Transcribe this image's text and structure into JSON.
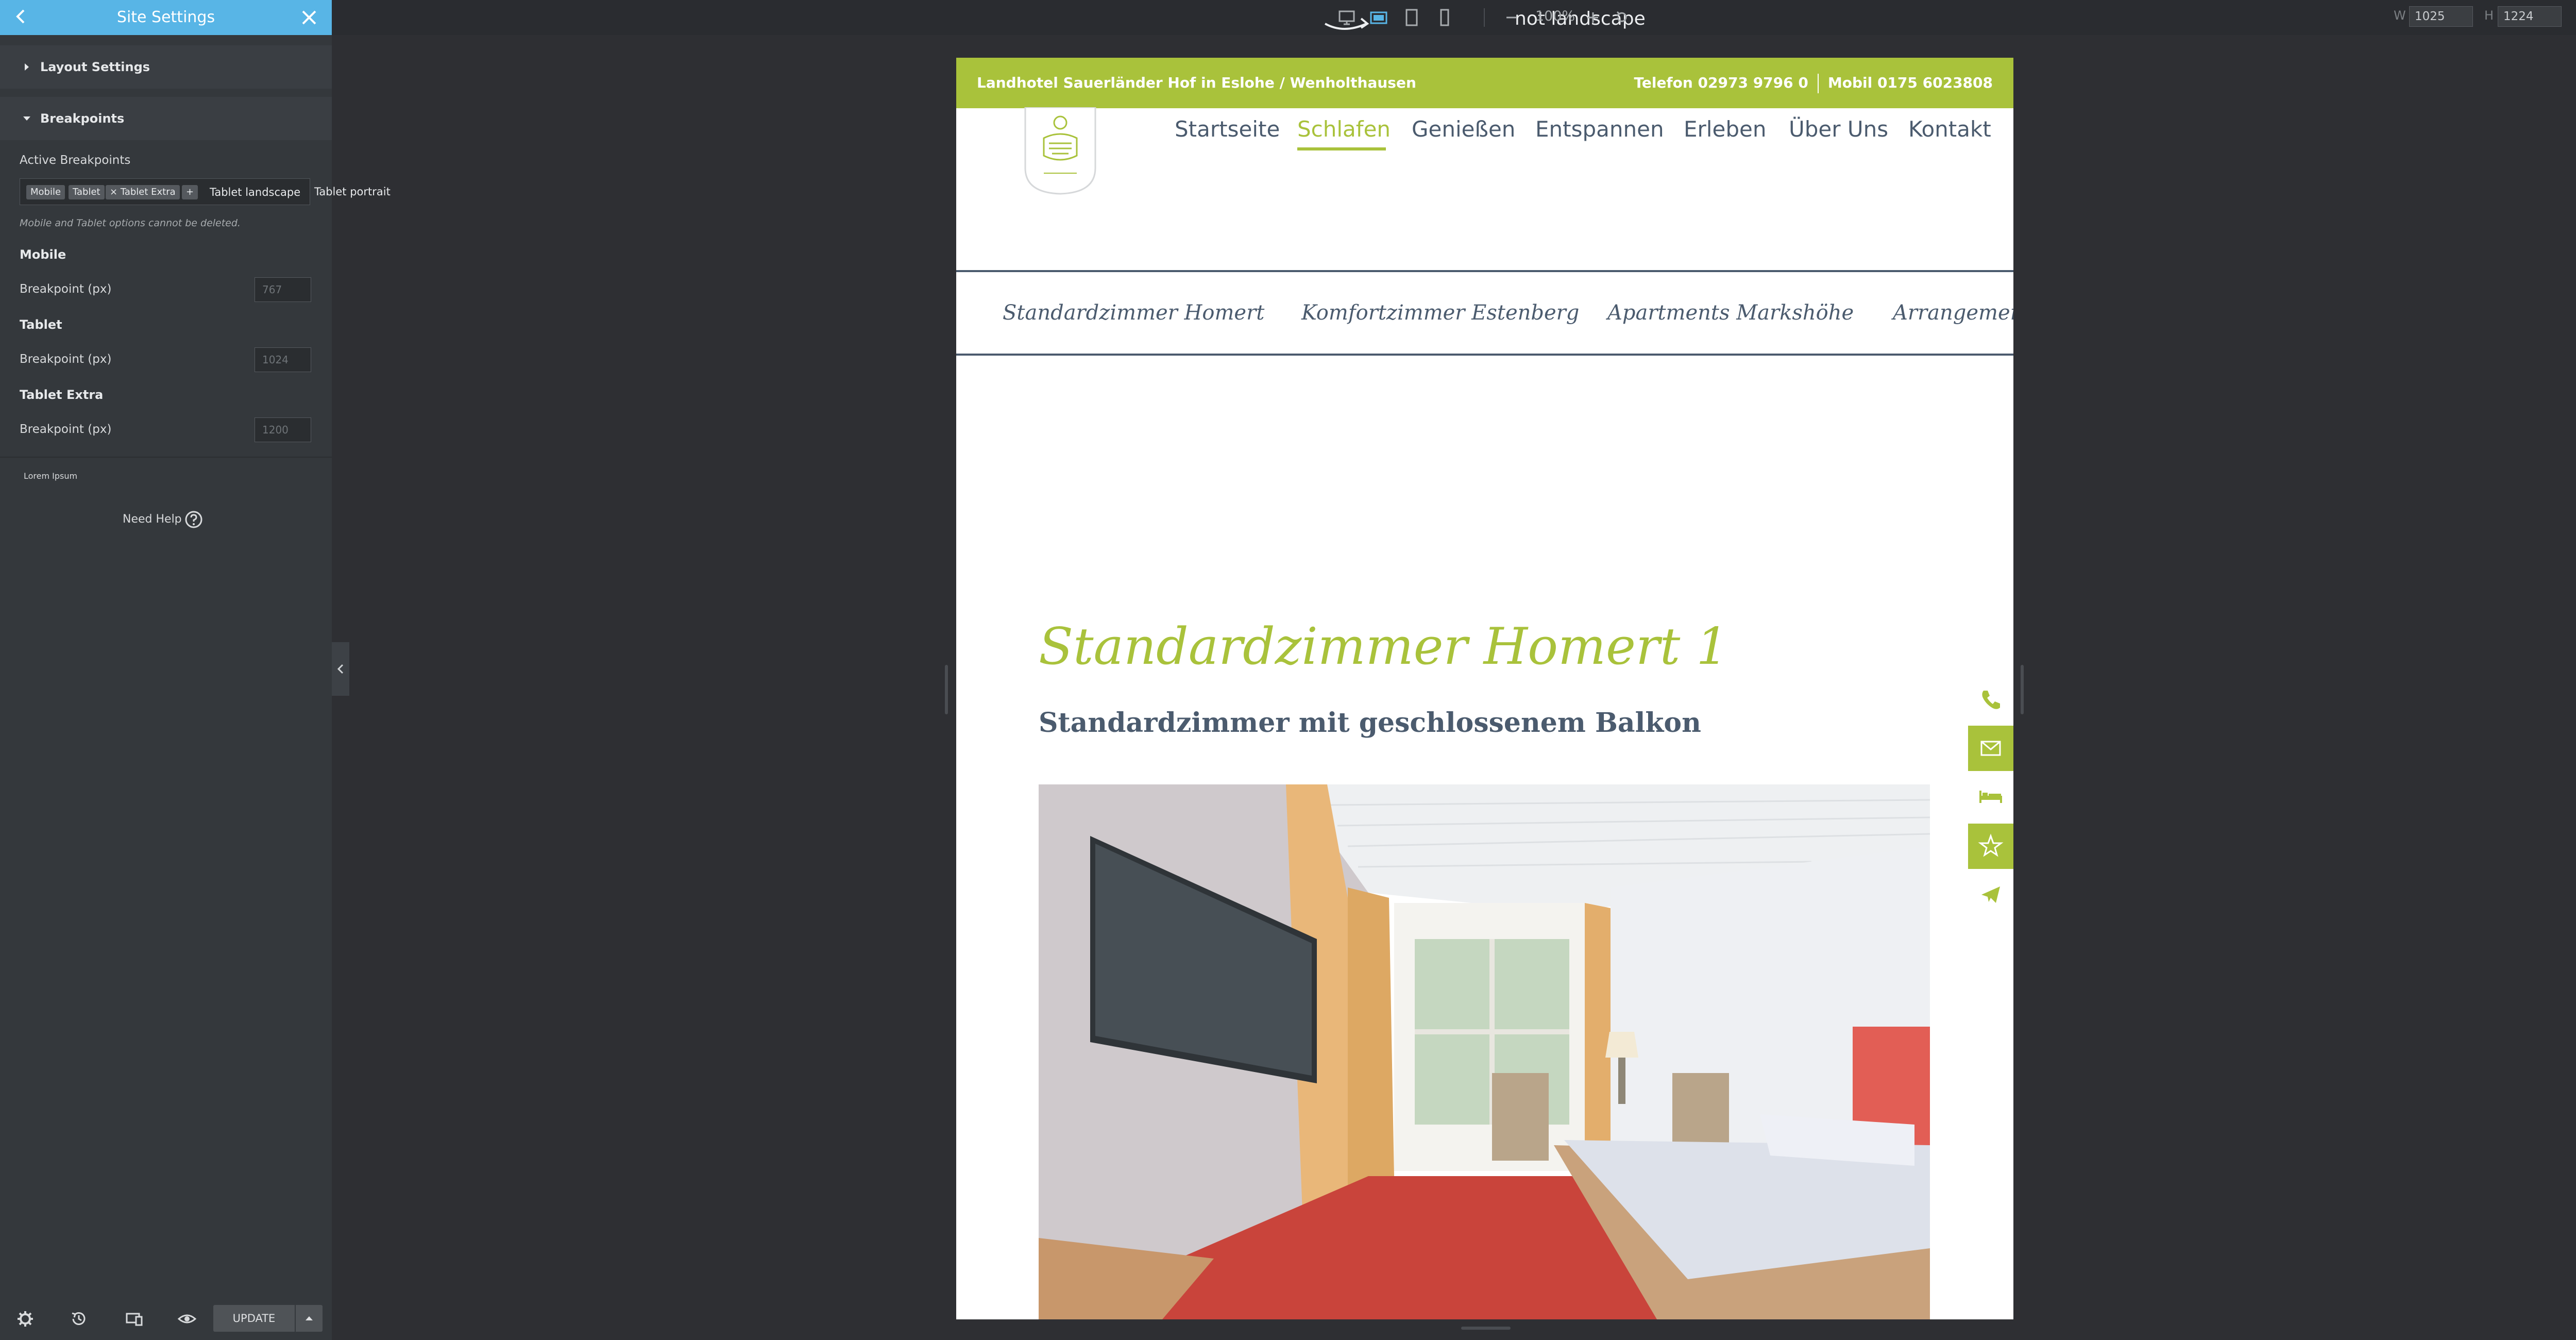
{
  "sidebar": {
    "title": "Site Settings",
    "sections": {
      "layout": "Layout Settings",
      "breakpoints": "Breakpoints"
    },
    "active_breakpoints_label": "Active Breakpoints",
    "tags": [
      "Mobile",
      "Tablet",
      "Tablet Extra"
    ],
    "tag_remove": "×",
    "add": "+",
    "option_landscape": "Tablet landscape",
    "option_portrait": "Tablet portrait",
    "note": "Mobile and Tablet options cannot be deleted.",
    "groups": [
      {
        "title": "Mobile",
        "field_label": "Breakpoint (px)",
        "placeholder": "767"
      },
      {
        "title": "Tablet",
        "field_label": "Breakpoint (px)",
        "placeholder": "1024"
      },
      {
        "title": "Tablet Extra",
        "field_label": "Breakpoint (px)",
        "placeholder": "1200"
      }
    ],
    "lorem": "Lorem Ipsum",
    "need_help": "Need Help",
    "update_label": "UPDATE"
  },
  "topbar": {
    "mode_note": "not landscape",
    "zoom": "100%",
    "width_label": "W",
    "width_value": "1025",
    "height_label": "H",
    "height_value": "1224"
  },
  "site": {
    "topbar_left": "Landhotel Sauerländer Hof in Eslohe / Wenholthausen",
    "phone": "Telefon 02973 9796 0",
    "mobile": "Mobil 0175 6023808",
    "nav": [
      "Startseite",
      "Schlafen",
      "Genießen",
      "Entspannen",
      "Erleben",
      "Über Uns",
      "Kontakt"
    ],
    "nav_active": "Schlafen",
    "sub_nav": [
      "Standardzimmer Homert",
      "Komfortzimmer Estenberg",
      "Apartments Markshöhe",
      "Arrangement"
    ],
    "room_title": "Standardzimmer Homert 1",
    "room_subtitle": "Standardzimmer mit geschlossenem Balkon",
    "side_icons": [
      "phone-icon",
      "mail-icon",
      "bed-icon",
      "star-icon",
      "send-icon"
    ],
    "colors": {
      "accent": "#a9c23b",
      "text": "#4b5b6e"
    }
  }
}
